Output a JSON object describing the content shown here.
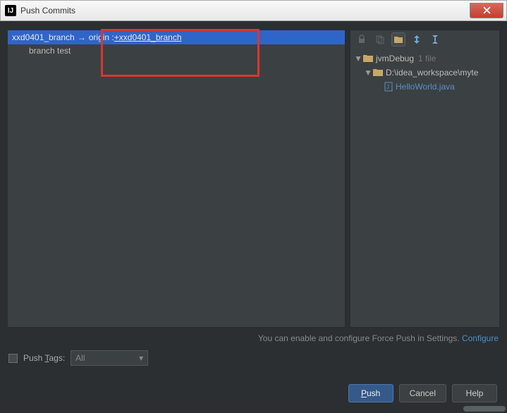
{
  "window": {
    "title": "Push Commits",
    "icon_glyph": "IJ"
  },
  "left": {
    "local_branch": "xxd0401_branch",
    "remote_prefix": "origin : ",
    "remote_branch": "+xxd0401_branch",
    "commit_message": "branch test"
  },
  "right": {
    "root_label": "jvmDebug",
    "root_count": "1 file",
    "path_label": "D:\\idea_workspace\\myte",
    "file_name": "HelloWorld.java"
  },
  "hint": {
    "text": "You can enable and configure Force Push in Settings. ",
    "link": "Configure"
  },
  "tags": {
    "label_before": "Push ",
    "label_underlined": "T",
    "label_after": "ags:",
    "combo_value": "All"
  },
  "buttons": {
    "push_u": "P",
    "push_rest": "ush",
    "cancel": "Cancel",
    "help": "Help"
  }
}
